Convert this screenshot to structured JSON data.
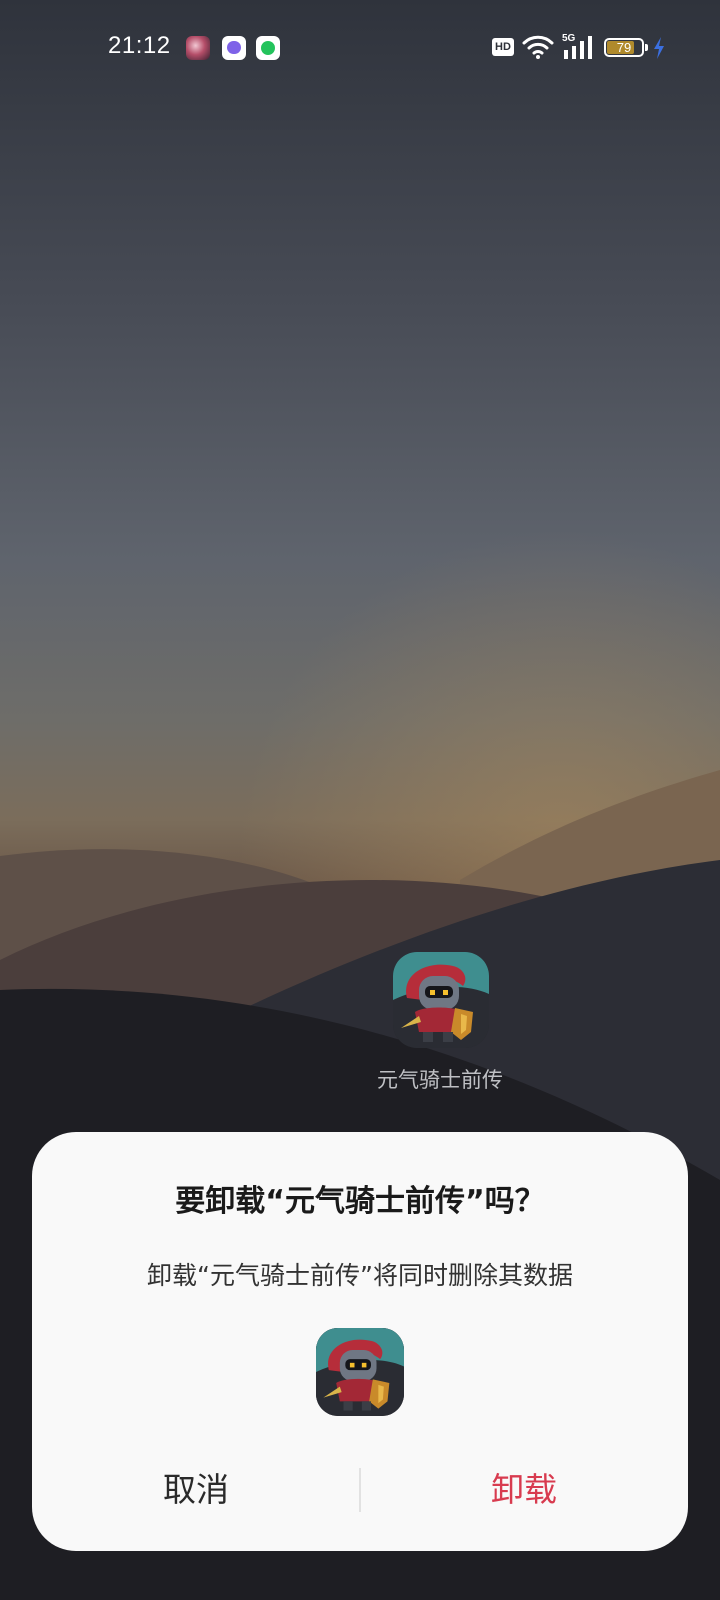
{
  "status_bar": {
    "time": "21:12",
    "hd_label": "HD",
    "network_type": "5G",
    "battery_level": "79",
    "battery_fraction": 0.79,
    "notification_icons": [
      "avatar-icon",
      "chat-app-icon",
      "message-app-icon"
    ],
    "indicator_icons": [
      "wifi-icon",
      "signal-icon",
      "battery-icon",
      "charging-icon"
    ]
  },
  "home": {
    "app_label": "元气骑士前传"
  },
  "dialog": {
    "title": "要卸载“元气骑士前传”吗？",
    "message": "卸载“元气骑士前传”将同时删除其数据",
    "cancel_label": "取消",
    "uninstall_label": "卸载"
  },
  "colors": {
    "dialog_background": "#f9f9f9",
    "uninstall_accent": "#d83b4f",
    "battery_fill": "#b08a2c"
  }
}
